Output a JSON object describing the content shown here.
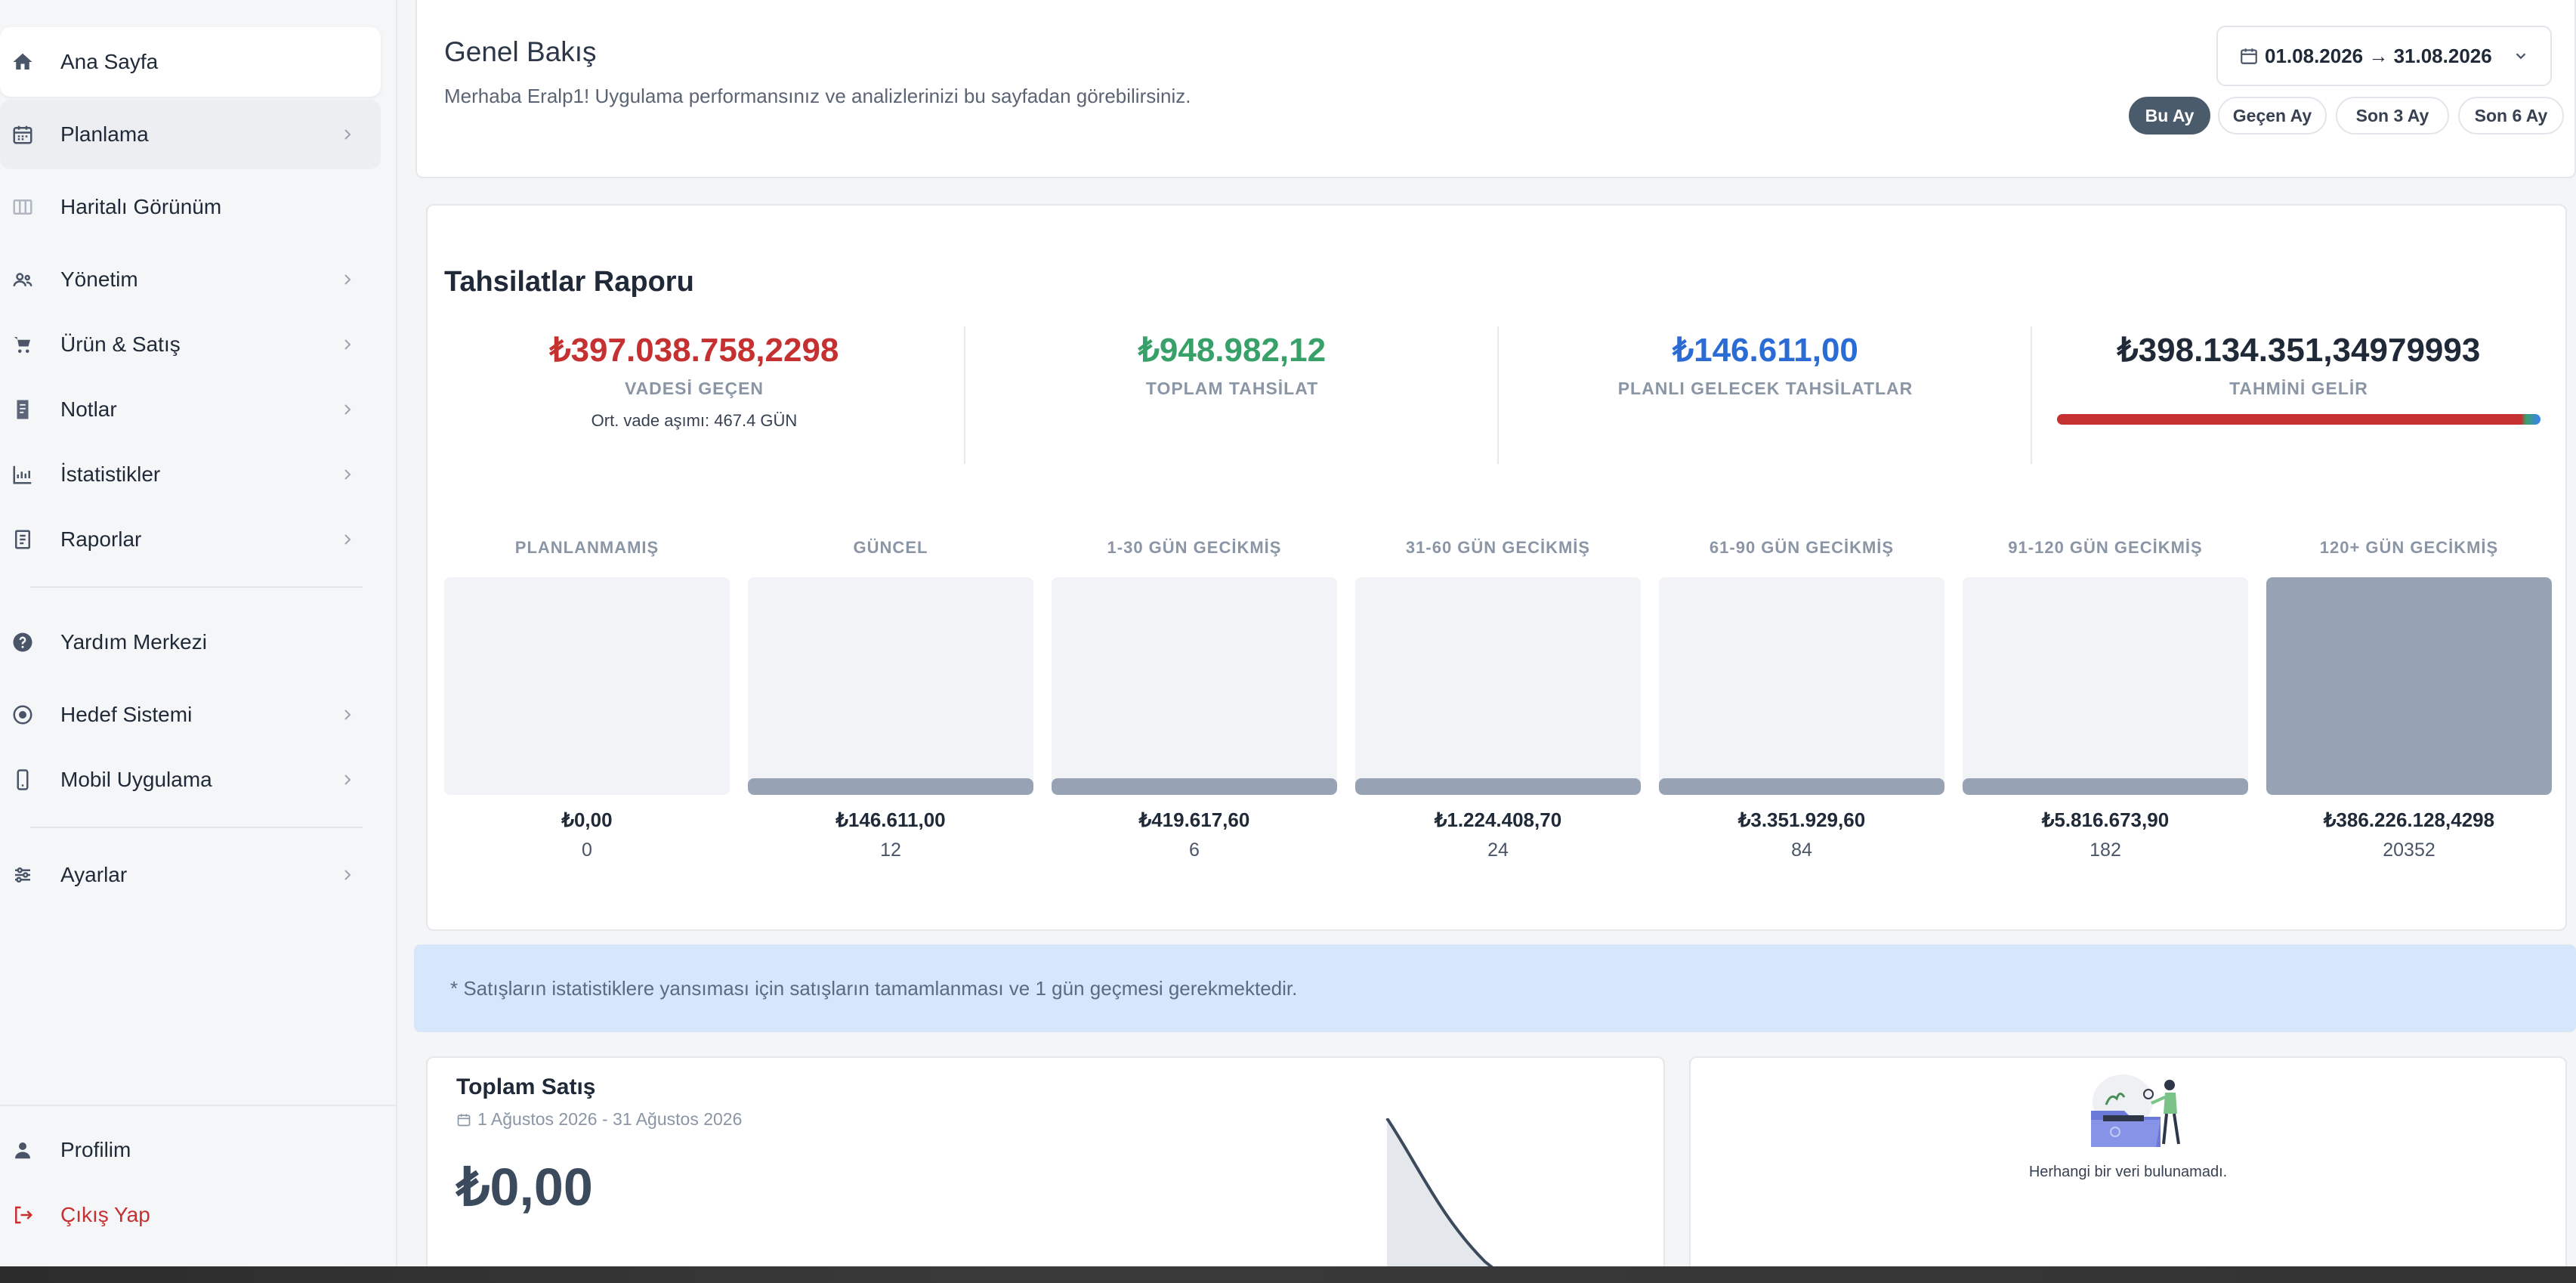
{
  "sidebar": {
    "items": [
      {
        "label": "Ana Sayfa",
        "icon": "home-icon",
        "chevron": false
      },
      {
        "label": "Planlama",
        "icon": "calendar-icon",
        "chevron": true
      },
      {
        "label": "Haritalı Görünüm",
        "icon": "map-icon",
        "chevron": false
      },
      {
        "label": "Yönetim",
        "icon": "users-icon",
        "chevron": true
      },
      {
        "label": "Ürün & Satış",
        "icon": "cart-icon",
        "chevron": true
      },
      {
        "label": "Notlar",
        "icon": "note-icon",
        "chevron": true
      },
      {
        "label": "İstatistikler",
        "icon": "chart-icon",
        "chevron": true
      },
      {
        "label": "Raporlar",
        "icon": "report-icon",
        "chevron": true
      },
      {
        "label": "Yardım Merkezi",
        "icon": "help-icon",
        "chevron": false
      },
      {
        "label": "Hedef Sistemi",
        "icon": "target-icon",
        "chevron": true
      },
      {
        "label": "Mobil Uygulama",
        "icon": "mobile-icon",
        "chevron": true
      },
      {
        "label": "Ayarlar",
        "icon": "settings-icon",
        "chevron": true
      }
    ],
    "profile_label": "Profilim",
    "logout_label": "Çıkış Yap"
  },
  "header": {
    "title": "Genel Bakış",
    "subtitle": "Merhaba Eralp1! Uygulama performansınız ve analizlerinizi bu sayfadan görebilirsiniz.",
    "date_range": "01.08.2026 → 31.08.2026",
    "ranges": [
      "Bu Ay",
      "Geçen Ay",
      "Son 3 Ay",
      "Son 6 Ay"
    ],
    "active_range": "Bu Ay"
  },
  "collections": {
    "title": "Tahsilatlar Raporu",
    "kpis": [
      {
        "value": "₺397.038.758,2298",
        "label": "VADESİ GEÇEN",
        "note": "Ort. vade aşımı: 467.4 GÜN",
        "color": "#c53030"
      },
      {
        "value": "₺948.982,12",
        "label": "TOPLAM TAHSİLAT",
        "color": "#38a169"
      },
      {
        "value": "₺146.611,00",
        "label": "PLANLI GELECEK TAHSİLATLAR",
        "color": "#2b6cd4"
      },
      {
        "value": "₺398.134.351,34979993",
        "label": "TAHMİNİ GELİR",
        "color": "#1f2937"
      }
    ],
    "buckets": [
      {
        "label": "PLANLANMAMIŞ",
        "amount": "₺0,00",
        "count": "0",
        "fill": 0
      },
      {
        "label": "GÜNCEL",
        "amount": "₺146.611,00",
        "count": "12",
        "fill": 0.04
      },
      {
        "label": "1-30 GÜN GECİKMİŞ",
        "amount": "₺419.617,60",
        "count": "6",
        "fill": 0.04
      },
      {
        "label": "31-60 GÜN GECİKMİŞ",
        "amount": "₺1.224.408,70",
        "count": "24",
        "fill": 0.04
      },
      {
        "label": "61-90 GÜN GECİKMİŞ",
        "amount": "₺3.351.929,60",
        "count": "84",
        "fill": 0.04
      },
      {
        "label": "91-120 GÜN GECİKMİŞ",
        "amount": "₺5.816.673,90",
        "count": "182",
        "fill": 0.04
      },
      {
        "label": "120+ GÜN GECİKMİŞ",
        "amount": "₺386.226.128,4298",
        "count": "20352",
        "fill": 1.0
      }
    ]
  },
  "info_banner": "* Satışların istatistiklere yansıması için satışların tamamlanması ve 1 gün geçmesi gerekmektedir.",
  "sales": {
    "title": "Toplam Satış",
    "range": "1 Ağustos 2026 - 31 Ağustos 2026",
    "value": "₺0,00"
  },
  "empty_state": {
    "text": "Herhangi bir veri bulunamadı."
  }
}
